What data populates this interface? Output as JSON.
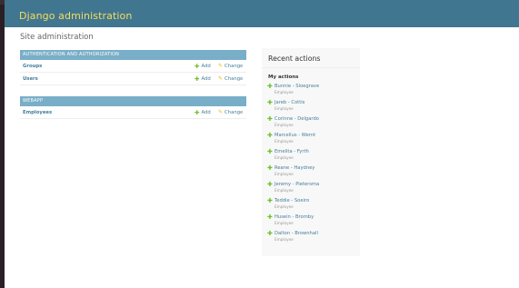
{
  "header": {
    "brand": "Django administration"
  },
  "page": {
    "title": "Site administration"
  },
  "modules": [
    {
      "caption": "Authentication and Authorization",
      "models": [
        {
          "name": "Groups",
          "add_label": "Add",
          "change_label": "Change"
        },
        {
          "name": "Users",
          "add_label": "Add",
          "change_label": "Change"
        }
      ]
    },
    {
      "caption": "Webapp",
      "models": [
        {
          "name": "Employees",
          "add_label": "Add",
          "change_label": "Change"
        }
      ]
    }
  ],
  "recent_actions": {
    "title": "Recent actions",
    "subtitle": "My actions",
    "items": [
      {
        "name": "Bunnie - Sloegrave",
        "type": "Employee"
      },
      {
        "name": "Jareb - Cottis",
        "type": "Employee"
      },
      {
        "name": "Corinne - Delgardo",
        "type": "Employee"
      },
      {
        "name": "Marcellus - Wernt",
        "type": "Employee"
      },
      {
        "name": "Emelita - Fyrth",
        "type": "Employee"
      },
      {
        "name": "Reane - Haydney",
        "type": "Employee"
      },
      {
        "name": "Jeremy - Pietersma",
        "type": "Employee"
      },
      {
        "name": "Teddie - Soeiro",
        "type": "Employee"
      },
      {
        "name": "Husein - Bromby",
        "type": "Employee"
      },
      {
        "name": "Dalton - Brownhall",
        "type": "Employee"
      }
    ]
  },
  "colors": {
    "header_bg": "#417690",
    "brand": "#f5dd5d",
    "caption_bg": "#79aec8",
    "link": "#447e9b",
    "add_icon": "#70bf2b",
    "change_icon": "#efb80b"
  },
  "icons": {
    "add": "plus-icon",
    "change": "pencil-icon"
  }
}
